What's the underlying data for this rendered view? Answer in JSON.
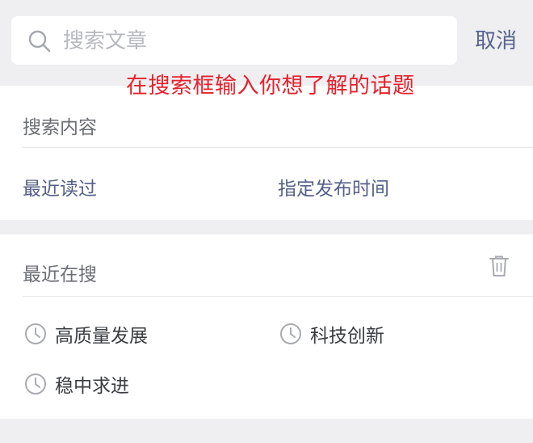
{
  "search": {
    "placeholder": "搜索文章",
    "cancel_label": "取消"
  },
  "annotation": {
    "text": "在搜索框输入你想了解的话题",
    "color": "#e5222c"
  },
  "search_content": {
    "title": "搜索内容",
    "options": [
      "最近读过",
      "指定发布时间"
    ]
  },
  "recent": {
    "title": "最近在搜",
    "items": [
      "高质量发展",
      "科技创新",
      "稳中求进"
    ]
  },
  "colors": {
    "accent": "#57638c",
    "background": "#efeff1"
  }
}
